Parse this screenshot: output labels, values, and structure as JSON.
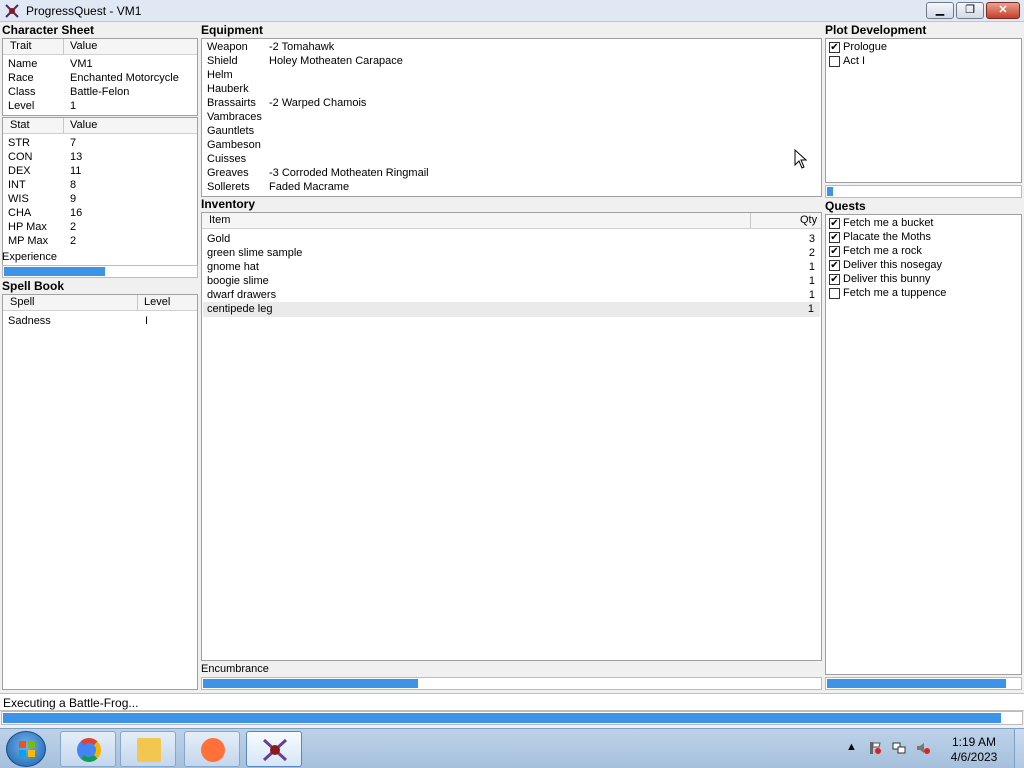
{
  "window": {
    "title": "ProgressQuest - VM1",
    "minimize_glyph": "▁",
    "maximize_glyph": "❐",
    "close_glyph": "✕"
  },
  "character_sheet": {
    "label": "Character Sheet",
    "trait_header": "Trait",
    "value_header": "Value",
    "traits": [
      {
        "trait": "Name",
        "value": "VM1"
      },
      {
        "trait": "Race",
        "value": "Enchanted Motorcycle"
      },
      {
        "trait": "Class",
        "value": "Battle-Felon"
      },
      {
        "trait": "Level",
        "value": "1"
      }
    ],
    "stat_header": "Stat",
    "stat_value_header": "Value",
    "stats": [
      {
        "stat": "STR",
        "value": "7"
      },
      {
        "stat": "CON",
        "value": "13"
      },
      {
        "stat": "DEX",
        "value": "11"
      },
      {
        "stat": "INT",
        "value": "8"
      },
      {
        "stat": "WIS",
        "value": "9"
      },
      {
        "stat": "CHA",
        "value": "16"
      },
      {
        "stat": "HP Max",
        "value": "2"
      },
      {
        "stat": "MP Max",
        "value": "2"
      }
    ],
    "experience_label": "Experience",
    "experience_progress": 0.53
  },
  "spell_book": {
    "label": "Spell Book",
    "spell_header": "Spell",
    "level_header": "Level",
    "spells": [
      {
        "spell": "Sadness",
        "level": "I"
      }
    ]
  },
  "equipment": {
    "label": "Equipment",
    "items": [
      {
        "slot": "Weapon",
        "item": "-2 Tomahawk"
      },
      {
        "slot": "Shield",
        "item": "Holey Motheaten Carapace"
      },
      {
        "slot": "Helm",
        "item": ""
      },
      {
        "slot": "Hauberk",
        "item": ""
      },
      {
        "slot": "Brassairts",
        "item": "-2 Warped Chamois"
      },
      {
        "slot": "Vambraces",
        "item": ""
      },
      {
        "slot": "Gauntlets",
        "item": ""
      },
      {
        "slot": "Gambeson",
        "item": ""
      },
      {
        "slot": "Cuisses",
        "item": ""
      },
      {
        "slot": "Greaves",
        "item": "-3 Corroded Motheaten Ringmail"
      },
      {
        "slot": "Sollerets",
        "item": "Faded Macrame"
      }
    ]
  },
  "inventory": {
    "label": "Inventory",
    "item_header": "Item",
    "qty_header": "Qty",
    "items": [
      {
        "item": "Gold",
        "qty": "3"
      },
      {
        "item": "green slime sample",
        "qty": "2"
      },
      {
        "item": "gnome hat",
        "qty": "1"
      },
      {
        "item": "boogie slime",
        "qty": "1"
      },
      {
        "item": "dwarf drawers",
        "qty": "1"
      },
      {
        "item": "centipede leg",
        "qty": "1"
      }
    ],
    "encumbrance_label": "Encumbrance",
    "encumbrance_progress": 0.35
  },
  "plot": {
    "label": "Plot Development",
    "acts": [
      {
        "label": "Prologue",
        "checked": true
      },
      {
        "label": "Act I",
        "checked": false
      }
    ],
    "progress": 0.04
  },
  "quests": {
    "label": "Quests",
    "items": [
      {
        "label": "Fetch me a bucket",
        "checked": true
      },
      {
        "label": "Placate the Moths",
        "checked": true
      },
      {
        "label": "Fetch me a rock",
        "checked": true
      },
      {
        "label": "Deliver this nosegay",
        "checked": true
      },
      {
        "label": "Deliver this bunny",
        "checked": true
      },
      {
        "label": "Fetch me a tuppence",
        "checked": false
      }
    ],
    "progress": 0.93
  },
  "status": {
    "text": "Executing a Battle-Frog...",
    "progress": 0.98
  },
  "taskbar": {
    "time": "1:19 AM",
    "date": "4/6/2023",
    "tray_arrow": "▲",
    "colors": {
      "chrome": "#4285f4",
      "firefox": "#ff7139",
      "explorer": "#f3c74f",
      "progressquest": "#6a3f91"
    }
  },
  "colors": {
    "progress_fill": "#3c93e8",
    "close_button": "#c4402c"
  }
}
